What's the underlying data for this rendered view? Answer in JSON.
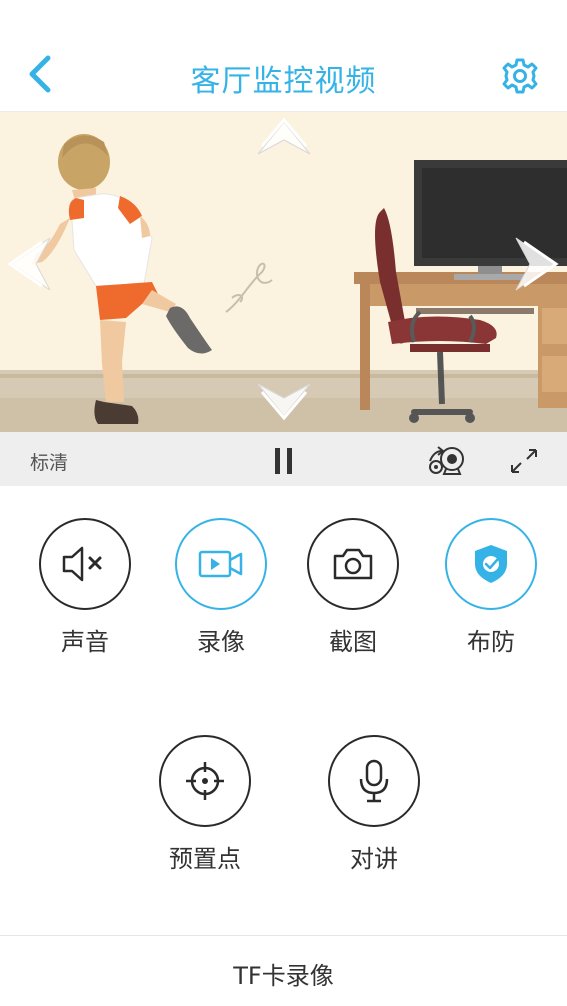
{
  "header": {
    "title": "客厅监控视频",
    "back_icon": "chevron-left-icon",
    "settings_icon": "gear-icon"
  },
  "video": {
    "quality_label": "标清",
    "pause_icon": "pause-icon",
    "camera_icon": "camera-switch-icon",
    "fullscreen_icon": "fullscreen-icon"
  },
  "actions": [
    {
      "label": "声音",
      "icon": "sound-muted-icon"
    },
    {
      "label": "录像",
      "icon": "video-record-icon"
    },
    {
      "label": "截图",
      "icon": "camera-icon"
    },
    {
      "label": "布防",
      "icon": "shield-check-icon"
    },
    {
      "label": "预置点",
      "icon": "crosshair-icon"
    },
    {
      "label": "对讲",
      "icon": "microphone-icon"
    }
  ],
  "footer": {
    "tf_record_label": "TF卡录像"
  },
  "colors": {
    "accent": "#35b3e6",
    "text": "#333333",
    "bar_bg": "#eeeeee",
    "video_bg": "#fbf3df"
  }
}
